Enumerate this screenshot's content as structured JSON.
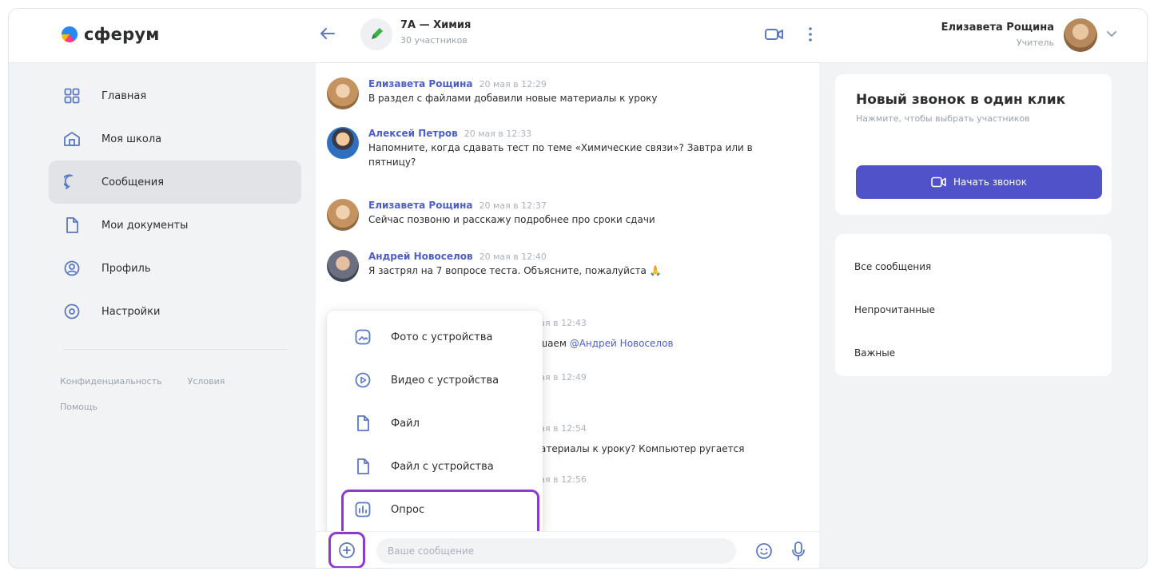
{
  "app": {
    "logo_text": "сферум"
  },
  "header": {
    "chat_title": "7А — Химия",
    "chat_subtitle": "30 участников",
    "user_name": "Елизавета Рощина",
    "user_role": "Учитель"
  },
  "sidebar": {
    "items": [
      {
        "label": "Главная",
        "icon": "home-grid-icon"
      },
      {
        "label": "Моя школа",
        "icon": "school-icon"
      },
      {
        "label": "Сообщения",
        "icon": "chat-bubble-icon",
        "active": true
      },
      {
        "label": "Мои документы",
        "icon": "document-icon"
      },
      {
        "label": "Профиль",
        "icon": "profile-icon"
      },
      {
        "label": "Настройки",
        "icon": "settings-icon"
      }
    ],
    "footer": {
      "privacy": "Конфиденциальность",
      "terms": "Условия",
      "help": "Помощь"
    }
  },
  "messages": [
    {
      "author": "Елизавета Рощина",
      "time": "20 мая в 12:29",
      "text": "В раздел с файлами добавили новые материалы к уроку"
    },
    {
      "author": "Алексей Петров",
      "time": "20 мая в 12:33",
      "text": "Напомните, когда сдавать тест по теме «Химические связи»? Завтра или в пятницу?"
    },
    {
      "author": "Елизавета Рощина",
      "time": "20 мая в 12:37",
      "text": "Сейчас позвоню и расскажу подробнее про сроки сдачи"
    },
    {
      "author": "Андрей Новоселов",
      "time": "20 мая в 12:40",
      "text": "Я застрял на 7 вопросе теста. Объясните, пожалуйста 🙏"
    }
  ],
  "partial_messages": [
    {
      "time": "мая в 12:43",
      "text_prefix": "ушаем",
      "mention": "@Андрей Новоселов"
    },
    {
      "time": "мая в 12:49",
      "text": ""
    },
    {
      "time": "мая в 12:54",
      "text": "материалы к уроку? Компьютер ругается"
    },
    {
      "time": "мая в 12:56",
      "text": ""
    }
  ],
  "attach_menu": {
    "items": [
      {
        "label": "Фото с устройства",
        "icon": "photo-icon"
      },
      {
        "label": "Видео с устройства",
        "icon": "video-play-icon"
      },
      {
        "label": "Файл",
        "icon": "file-icon"
      },
      {
        "label": "Файл с устройства",
        "icon": "file-device-icon"
      },
      {
        "label": "Опрос",
        "icon": "poll-icon",
        "highlighted": true
      }
    ]
  },
  "composer": {
    "placeholder": "Ваше сообщение"
  },
  "right_panel": {
    "call_card": {
      "title": "Новый звонок в один клик",
      "subtitle": "Нажмите, чтобы выбрать участников",
      "button_label": "Начать звонок"
    },
    "filters": [
      "Все сообщения",
      "Непрочитанные",
      "Важные"
    ]
  },
  "colors": {
    "accent": "#4f52c9",
    "highlight": "#8c3ad1",
    "author": "#4d5ec9",
    "background": "#f2f3f5"
  }
}
